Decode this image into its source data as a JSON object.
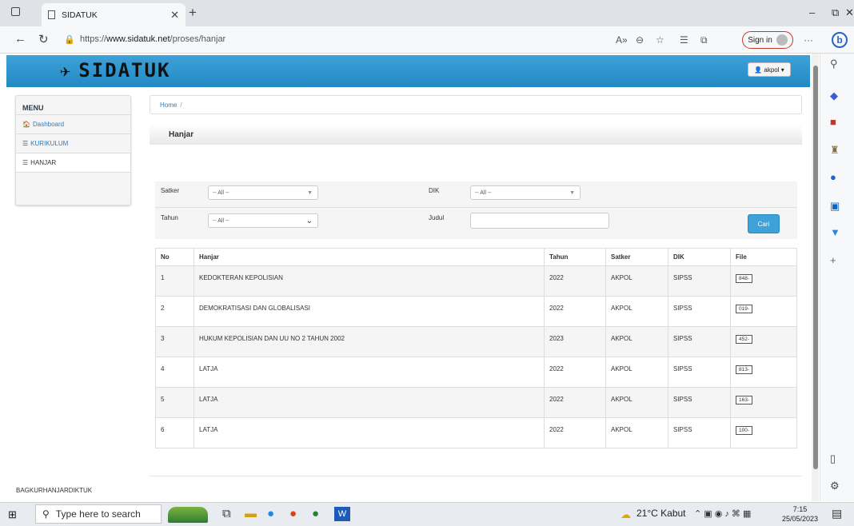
{
  "browser": {
    "tab_title": "SIDATUK",
    "url_prefix": "https://",
    "url_host": "www.sidatuk.net",
    "url_path": "/proses/hanjar",
    "sign_in": "Sign in"
  },
  "site": {
    "logo_text": "SIDATUK",
    "user_label": "akpol",
    "accent": "#2f96d0"
  },
  "menu": {
    "title": "MENU",
    "items": [
      {
        "label": "Dashboard",
        "icon": "home-icon"
      },
      {
        "label": "KURIKULUM",
        "icon": "list-icon"
      },
      {
        "label": "HANJAR",
        "icon": "list-icon"
      }
    ]
  },
  "breadcrumb": {
    "home": "Home",
    "sep": "/"
  },
  "panel": {
    "title": "Hanjar"
  },
  "filter": {
    "satker_label": "Satker",
    "satker_value": "-- All --",
    "dik_label": "DIK",
    "dik_value": "-- All --",
    "tahun_label": "Tahun",
    "tahun_value": "-- All --",
    "judul_label": "Judul",
    "judul_value": "",
    "search_button": "Cari"
  },
  "table": {
    "headers": [
      "No",
      "Hanjar",
      "Tahun",
      "Satker",
      "DIK",
      "File"
    ],
    "rows": [
      {
        "no": "1",
        "hanjar": "KEDOKTERAN KEPOLISIAN",
        "tahun": "2022",
        "satker": "AKPOL",
        "dik": "SIPSS",
        "file": "848-"
      },
      {
        "no": "2",
        "hanjar": "DEMOKRATISASI DAN GLOBALISASI",
        "tahun": "2022",
        "satker": "AKPOL",
        "dik": "SIPSS",
        "file": "019-"
      },
      {
        "no": "3",
        "hanjar": "HUKUM KEPOLISIAN DAN UU NO 2 TAHUN 2002",
        "tahun": "2023",
        "satker": "AKPOL",
        "dik": "SIPSS",
        "file": "452-"
      },
      {
        "no": "4",
        "hanjar": "LATJA",
        "tahun": "2022",
        "satker": "AKPOL",
        "dik": "SIPSS",
        "file": "813-"
      },
      {
        "no": "5",
        "hanjar": "LATJA",
        "tahun": "2022",
        "satker": "AKPOL",
        "dik": "SIPSS",
        "file": "163-"
      },
      {
        "no": "6",
        "hanjar": "LATJA",
        "tahun": "2022",
        "satker": "AKPOL",
        "dik": "SIPSS",
        "file": "100-"
      }
    ]
  },
  "footer": {
    "text": "BAGKURHANJARDIKTUK"
  },
  "taskbar": {
    "search_placeholder": "Type here to search",
    "weather": "21°C  Kabut",
    "time": "7:15",
    "date": "25/05/2023"
  }
}
